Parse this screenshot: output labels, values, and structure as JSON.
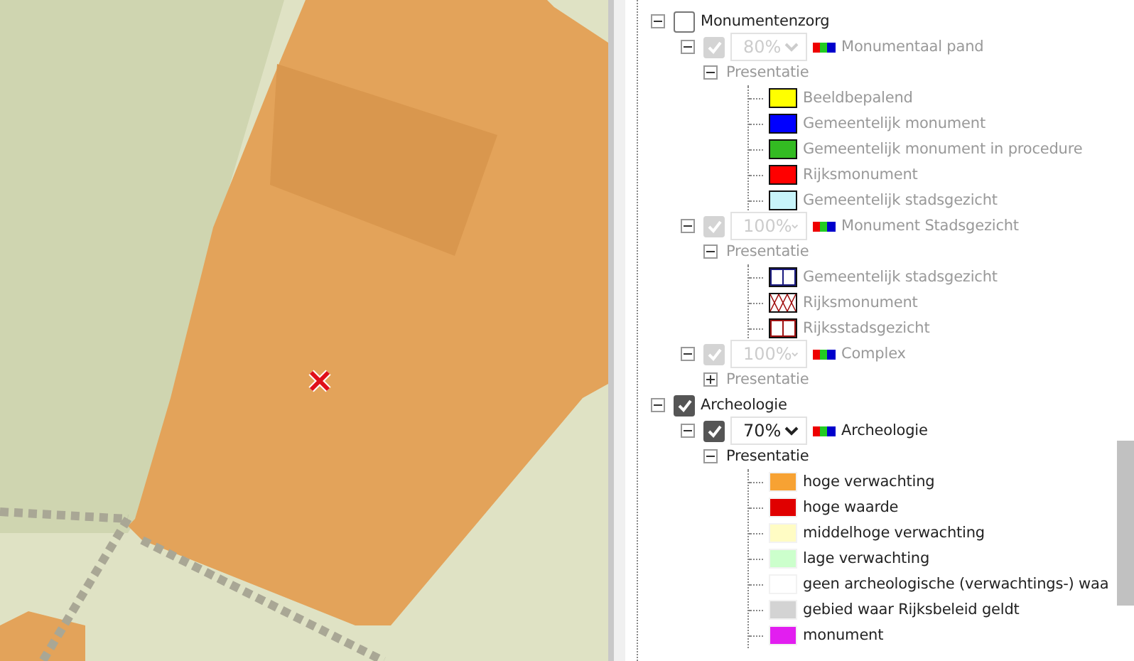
{
  "groups": [
    {
      "label": "Monumentenzorg",
      "checked": false,
      "expanded": true,
      "layers": [
        {
          "label": "Monumentaal pand",
          "opacity": "80%",
          "checked": true,
          "disabled": true,
          "expanded": true,
          "presentation": {
            "label": "Presentatie",
            "expanded": true,
            "items": [
              {
                "label": "Beeldbepalend",
                "kind": "solid",
                "color": "#ffff00"
              },
              {
                "label": "Gemeentelijk monument",
                "kind": "solid",
                "color": "#0000ff"
              },
              {
                "label": "Gemeentelijk monument in procedure",
                "kind": "solid",
                "color": "#33bb22"
              },
              {
                "label": "Rijksmonument",
                "kind": "solid",
                "color": "#ff0000"
              },
              {
                "label": "Gemeentelijk stadsgezicht",
                "kind": "solid",
                "color": "#c8f4fa"
              }
            ]
          }
        },
        {
          "label": "Monument Stadsgezicht",
          "opacity": "100%",
          "checked": true,
          "disabled": true,
          "expanded": true,
          "presentation": {
            "label": "Presentatie",
            "expanded": true,
            "items": [
              {
                "label": "Gemeentelijk stadsgezicht",
                "kind": "lines",
                "color": "#1a1a80"
              },
              {
                "label": "Rijksmonument",
                "kind": "cross",
                "color": "#a01010"
              },
              {
                "label": "Rijksstadsgezicht",
                "kind": "lines",
                "color": "#a01010"
              }
            ]
          }
        },
        {
          "label": "Complex",
          "opacity": "100%",
          "checked": true,
          "disabled": true,
          "expanded": true,
          "presentation": {
            "label": "Presentatie",
            "expanded": false
          }
        }
      ]
    },
    {
      "label": "Archeologie",
      "checked": true,
      "expanded": true,
      "layers": [
        {
          "label": "Archeologie",
          "opacity": "70%",
          "checked": true,
          "disabled": false,
          "expanded": true,
          "presentation": {
            "label": "Presentatie",
            "expanded": true,
            "items": [
              {
                "label": "hoge verwachting",
                "kind": "flat",
                "color": "#f7a233"
              },
              {
                "label": "hoge waarde",
                "kind": "flat",
                "color": "#e00000"
              },
              {
                "label": "middelhoge verwachting",
                "kind": "flat",
                "color": "#fffcc4"
              },
              {
                "label": "lage verwachting",
                "kind": "flat",
                "color": "#ccffcc"
              },
              {
                "label": "geen archeologische (verwachtings-) waa",
                "kind": "flat",
                "color": "#ffffff"
              },
              {
                "label": "gebied waar Rijksbeleid geldt",
                "kind": "flat",
                "color": "#d3d3d3"
              },
              {
                "label": "monument",
                "kind": "flat",
                "color": "#e21ef0"
              }
            ]
          }
        }
      ]
    }
  ]
}
